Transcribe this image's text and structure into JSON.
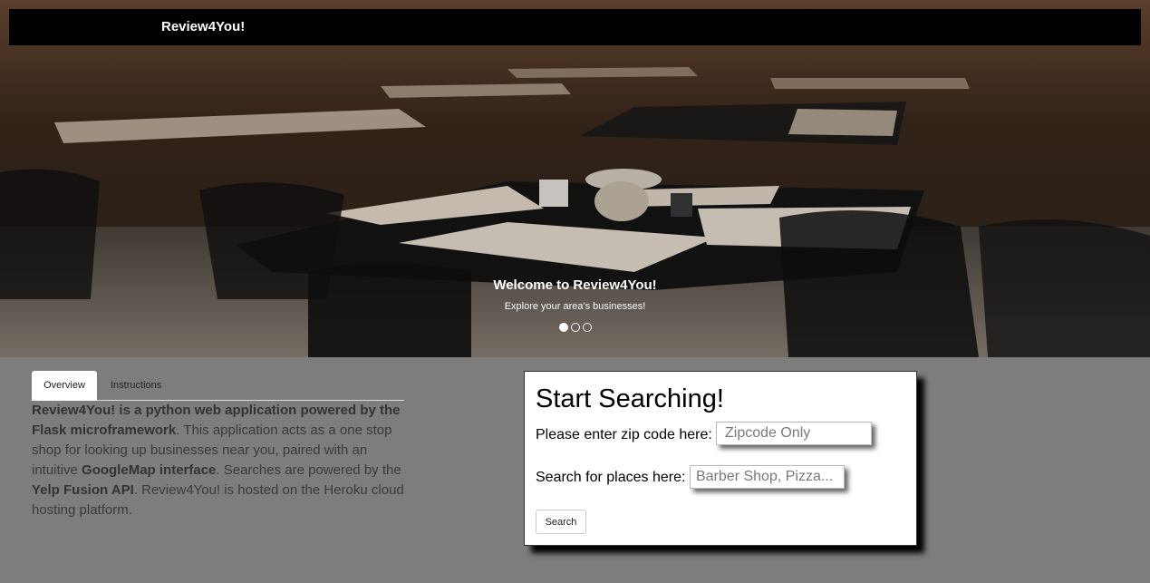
{
  "navbar": {
    "brand": "Review4You!"
  },
  "carousel": {
    "caption_title": "Welcome to Review4You!",
    "caption_subtitle": "Explore your area's businesses!",
    "slide_count": 3,
    "active_slide": 1
  },
  "tabs": [
    {
      "label": "Overview",
      "active": true
    },
    {
      "label": "Instructions",
      "active": false
    }
  ],
  "overview": {
    "segments": [
      {
        "text": "Review4You! is a python web application powered by the Flask microframework",
        "bold": true
      },
      {
        "text": ". This application acts as a one stop shop for looking up businesses near you, paired with an intuitive ",
        "bold": false
      },
      {
        "text": "GoogleMap interface",
        "bold": true
      },
      {
        "text": ". Searches are powered by the ",
        "bold": false
      },
      {
        "text": "Yelp Fusion API",
        "bold": true
      },
      {
        "text": ". Review4You! is hosted on the Heroku cloud hosting platform.",
        "bold": false
      }
    ]
  },
  "search": {
    "title": "Start Searching!",
    "zip_label": "Please enter zip code here:",
    "zip_placeholder": "Zipcode Only",
    "place_label": "Search for places here:",
    "place_placeholder": "Barber Shop, Pizza...",
    "button_label": "Search"
  },
  "colors": {
    "page_background": "#7d7d7d",
    "navbar": "#000000",
    "card": "#ffffff"
  }
}
